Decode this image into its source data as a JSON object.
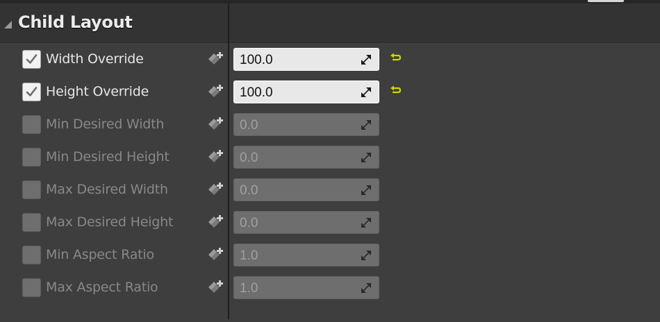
{
  "section": {
    "title": "Child Layout"
  },
  "rows": [
    {
      "label": "Width Override",
      "value": "100.0",
      "enabled": true,
      "reset": true
    },
    {
      "label": "Height Override",
      "value": "100.0",
      "enabled": true,
      "reset": true
    },
    {
      "label": "Min Desired Width",
      "value": "0.0",
      "enabled": false,
      "reset": false
    },
    {
      "label": "Min Desired Height",
      "value": "0.0",
      "enabled": false,
      "reset": false
    },
    {
      "label": "Max Desired Width",
      "value": "0.0",
      "enabled": false,
      "reset": false
    },
    {
      "label": "Max Desired Height",
      "value": "0.0",
      "enabled": false,
      "reset": false
    },
    {
      "label": "Min Aspect Ratio",
      "value": "1.0",
      "enabled": false,
      "reset": false
    },
    {
      "label": "Max Aspect Ratio",
      "value": "1.0",
      "enabled": false,
      "reset": false
    }
  ],
  "icons": {
    "collapse": "collapse-triangle-icon",
    "keyframe": "add-keyframe-icon",
    "drag": "value-drag-handle-icon",
    "reset": "reset-to-default-icon"
  },
  "colors": {
    "reset_accent": "#cfd600",
    "panel_bg": "#3e3e3e",
    "header_bg": "#333333"
  }
}
